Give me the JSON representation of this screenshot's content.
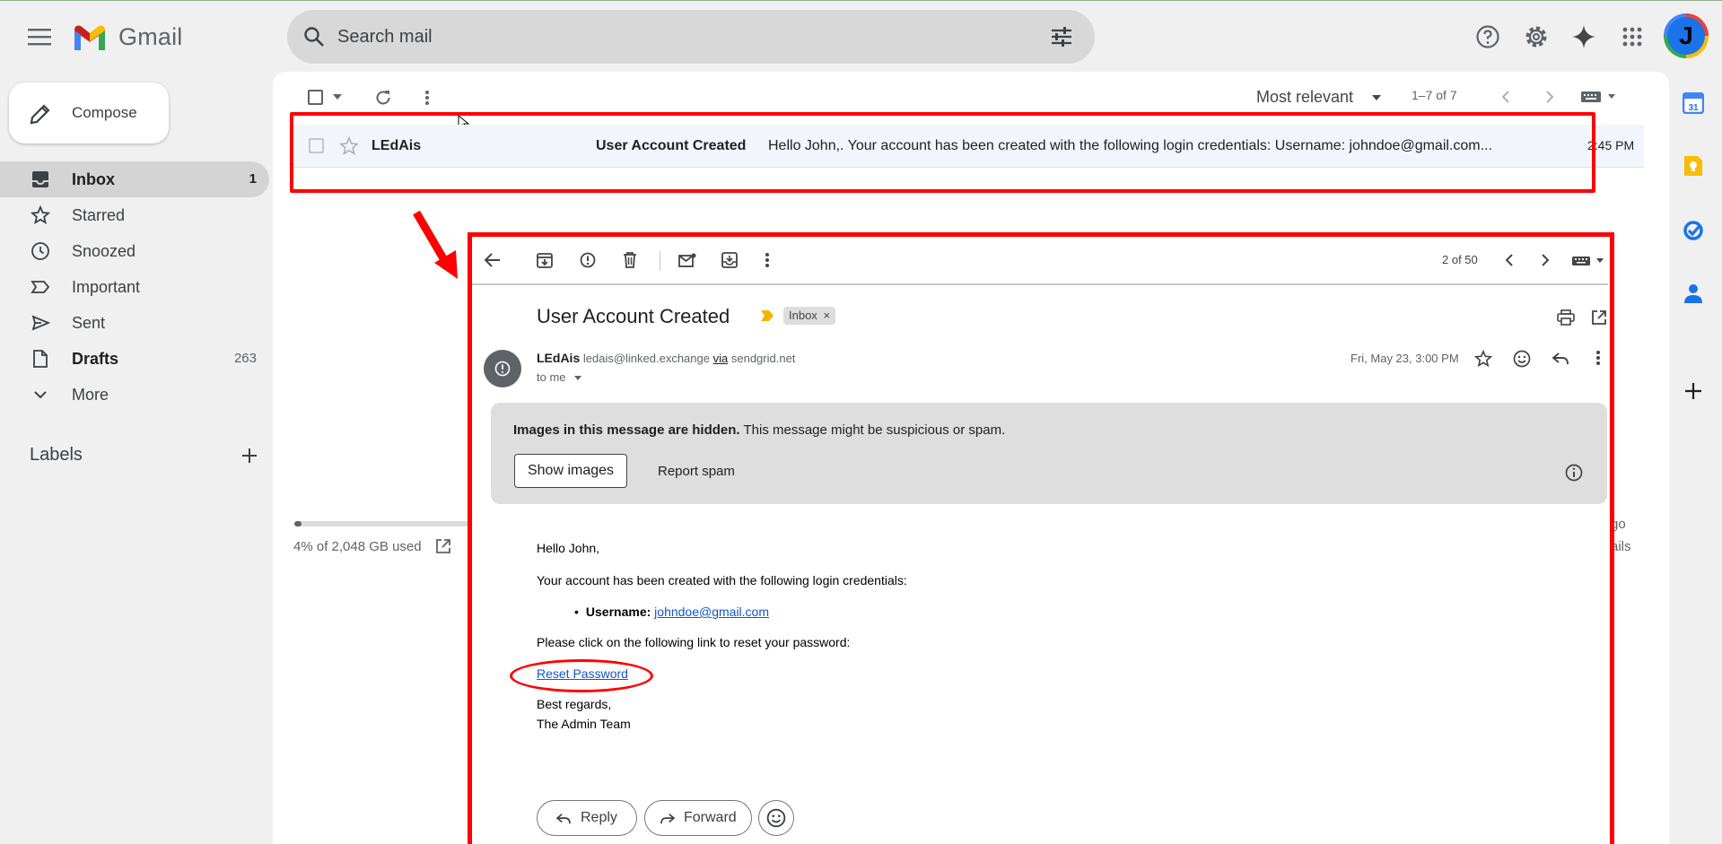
{
  "app": {
    "logo_text": "Gmail",
    "search_placeholder": "Search mail",
    "avatar_letter": "J"
  },
  "sidebar": {
    "compose_label": "Compose",
    "items": [
      {
        "label": "Inbox",
        "count": "1"
      },
      {
        "label": "Starred",
        "count": ""
      },
      {
        "label": "Snoozed",
        "count": ""
      },
      {
        "label": "Important",
        "count": ""
      },
      {
        "label": "Sent",
        "count": ""
      },
      {
        "label": "Drafts",
        "count": "263"
      },
      {
        "label": "More",
        "count": ""
      }
    ],
    "labels_header": "Labels"
  },
  "toolbar": {
    "sort_label": "Most relevant",
    "page_range": "1–7 of 7"
  },
  "email_row": {
    "sender": "LEdAis",
    "subject": "User Account Created",
    "snippet": "Hello John,. Your account has been created with the following login credentials: Username: johndoe@gmail.com...",
    "time": "2:45 PM"
  },
  "storage": {
    "used_text": "4% of 2,048 GB used",
    "percent": 4
  },
  "partial_right": {
    "line1": "go",
    "line2": "ails"
  },
  "message": {
    "position": "2 of 50",
    "subject": "User Account Created",
    "label_chip": "Inbox",
    "sender_name": "LEdAis",
    "sender_email": "ledais@linked.exchange",
    "via_word": "via",
    "via_domain": "sendgrid.net",
    "to_line": "to me",
    "date": "Fri, May 23, 3:00 PM",
    "warning_bold": "Images in this message are hidden.",
    "warning_rest": " This message might be suspicious or spam.",
    "show_images": "Show images",
    "report_spam": "Report spam",
    "greeting": "Hello John,",
    "line1": "Your account has been created with the following login credentials:",
    "username_label": "Username:",
    "username_value": "johndoe@gmail.com",
    "line2": "Please click on the following link to reset your password:",
    "reset_link": "Reset Password",
    "regards": "Best regards,",
    "team": "The Admin Team",
    "reply": "Reply",
    "forward": "Forward"
  },
  "colors": {
    "annotation_red": "#ff0000",
    "link_blue": "#1155cc",
    "selected_row": "#f2f6fc"
  }
}
